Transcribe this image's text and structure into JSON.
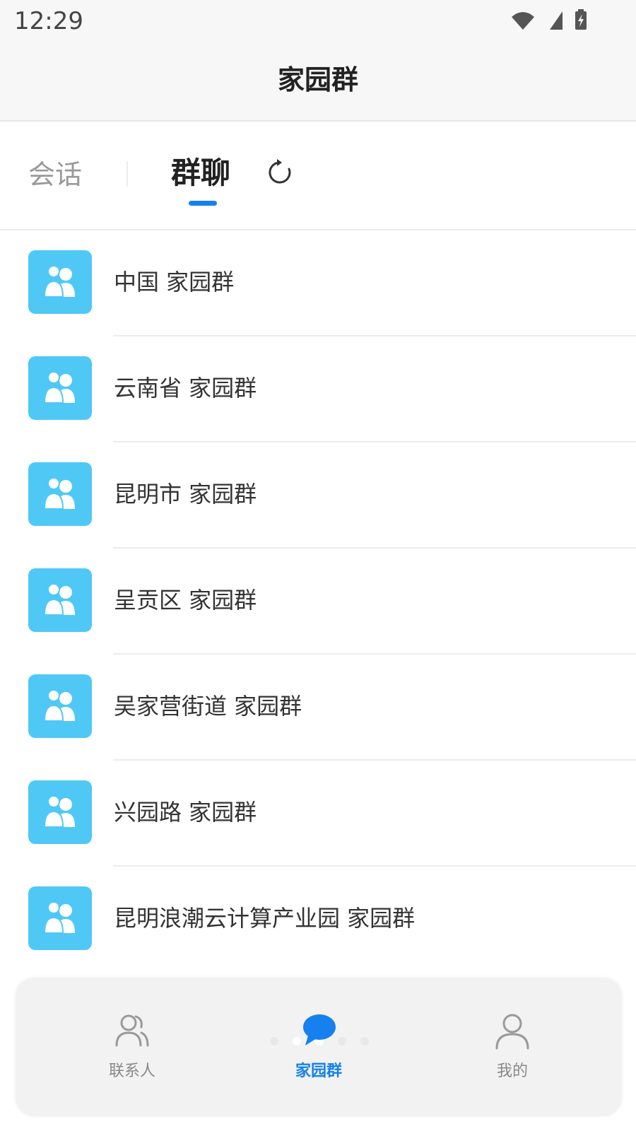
{
  "status_bar": {
    "time": "12:29"
  },
  "header": {
    "title": "家园群"
  },
  "tabs": {
    "items": [
      {
        "label": "会话",
        "active": false
      },
      {
        "label": "群聊",
        "active": true
      }
    ],
    "refresh_icon": "refresh-icon"
  },
  "groups": [
    {
      "name": "中国 家园群"
    },
    {
      "name": "云南省 家园群"
    },
    {
      "name": "昆明市 家园群"
    },
    {
      "name": "呈贡区 家园群"
    },
    {
      "name": "吴家营街道 家园群"
    },
    {
      "name": "兴园路 家园群"
    },
    {
      "name": "昆明浪潮云计算产业园 家园群"
    }
  ],
  "bottom_nav": {
    "items": [
      {
        "label": "联系人",
        "icon": "contacts-icon",
        "active": false
      },
      {
        "label": "家园群",
        "icon": "chat-bubble-icon",
        "active": true
      },
      {
        "label": "我的",
        "icon": "user-icon",
        "active": false
      }
    ]
  },
  "colors": {
    "accent": "#1580ee",
    "avatar_bg": "#4fc8f6",
    "inactive_text": "#999999"
  }
}
